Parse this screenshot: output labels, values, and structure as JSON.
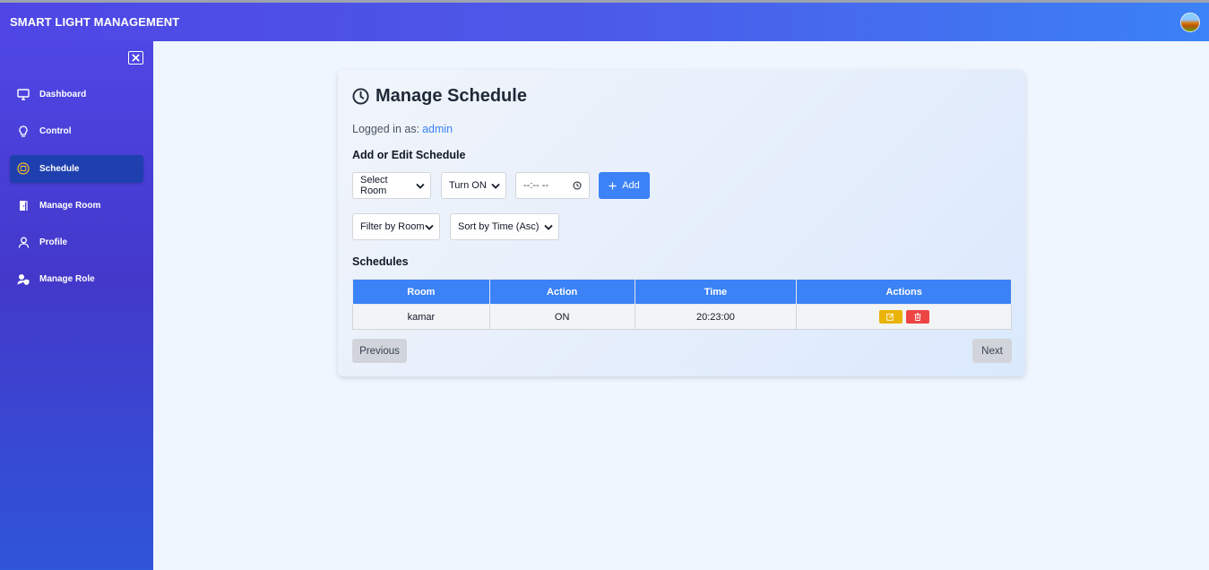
{
  "app": {
    "title": "SMART LIGHT MANAGEMENT",
    "avatar_icon": "user-avatar"
  },
  "sidebar": {
    "close_icon": "close-square-icon",
    "items": [
      {
        "label": "Dashboard",
        "icon": "monitor-icon",
        "active": false
      },
      {
        "label": "Control",
        "icon": "lightbulb-icon",
        "active": false
      },
      {
        "label": "Schedule",
        "icon": "calendar-circle-icon",
        "active": true
      },
      {
        "label": "Manage Room",
        "icon": "door-icon",
        "active": false
      },
      {
        "label": "Profile",
        "icon": "user-icon",
        "active": false
      },
      {
        "label": "Manage Role",
        "icon": "user-shield-icon",
        "active": false
      }
    ]
  },
  "page": {
    "title": "Manage Schedule",
    "logged_in_label": "Logged in as:",
    "logged_in_user": "admin",
    "form_title": "Add or Edit Schedule",
    "room_select": "Select Room",
    "action_select": "Turn ON",
    "time_placeholder": "--:-- --",
    "add_label": "Add",
    "filter_select": "Filter by Room",
    "sort_select": "Sort by Time (Asc)",
    "list_title": "Schedules"
  },
  "table": {
    "headers": [
      "Room",
      "Action",
      "Time",
      "Actions"
    ],
    "rows": [
      {
        "room": "kamar",
        "action": "ON",
        "time": "20:23:00"
      }
    ]
  },
  "pagination": {
    "previous": "Previous",
    "next": "Next"
  },
  "colors": {
    "primary": "#3b82f6",
    "sidebar": "#4f46e5",
    "active_nav": "#1e40af",
    "edit": "#eab308",
    "delete": "#ef4444"
  }
}
